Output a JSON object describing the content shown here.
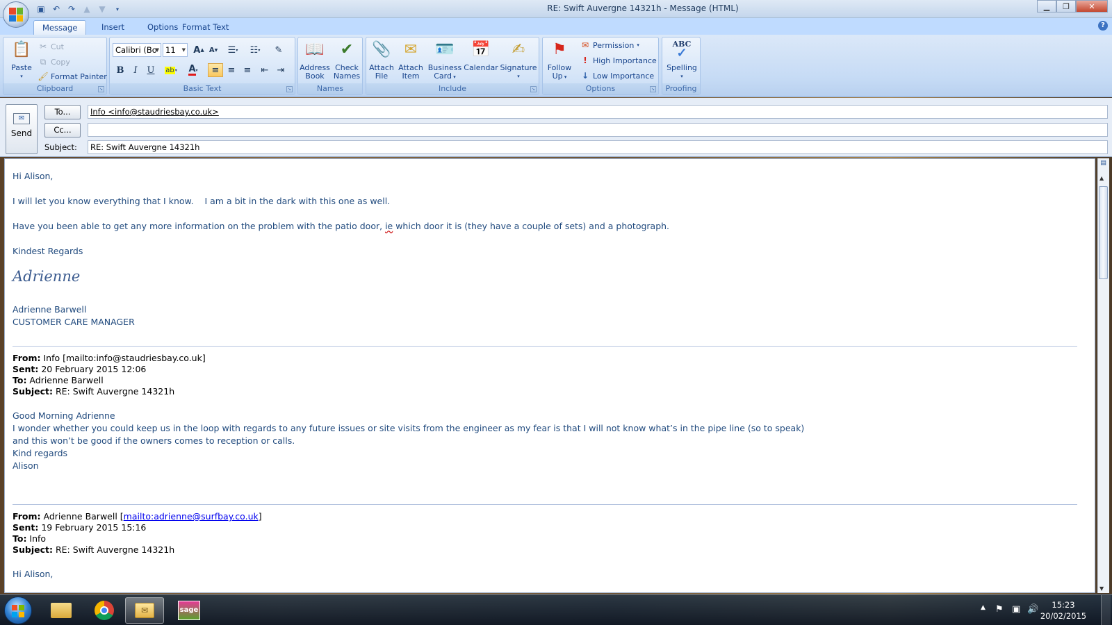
{
  "window": {
    "title": "RE: Swift Auvergne 14321h - Message (HTML)"
  },
  "tabs": [
    "Message",
    "Insert",
    "Options",
    "Format Text"
  ],
  "ribbon": {
    "clipboard": {
      "label": "Clipboard",
      "paste": "Paste",
      "cut": "Cut",
      "copy": "Copy",
      "format_painter": "Format Painter"
    },
    "basic_text": {
      "label": "Basic Text",
      "font": "Calibri (Bo",
      "size": "11",
      "bold": "B",
      "italic": "I",
      "underline": "U"
    },
    "names": {
      "label": "Names",
      "address_book_1": "Address",
      "address_book_2": "Book",
      "check_names_1": "Check",
      "check_names_2": "Names"
    },
    "include": {
      "label": "Include",
      "attach_file_1": "Attach",
      "attach_file_2": "File",
      "attach_item_1": "Attach",
      "attach_item_2": "Item",
      "business_card_1": "Business",
      "business_card_2": "Card",
      "calendar": "Calendar",
      "signature": "Signature"
    },
    "options": {
      "label": "Options",
      "follow_up_1": "Follow",
      "follow_up_2": "Up",
      "permission": "Permission",
      "high_importance": "High Importance",
      "low_importance": "Low Importance"
    },
    "proofing": {
      "label": "Proofing",
      "spelling_icon": "ABC",
      "spelling": "Spelling"
    }
  },
  "header": {
    "send": "Send",
    "to_button": "To...",
    "cc_button": "Cc...",
    "subject_label": "Subject:",
    "to_value": "Info <info@staudriesbay.co.uk>",
    "cc_value": "",
    "subject_value": "RE: Swift Auvergne 14321h"
  },
  "body": {
    "greeting": "Hi Alison,",
    "line1": "I will let you know everything that I know.    I am a bit in the dark with this one as well.",
    "line2_pre": "Have you been able to get any more information on the problem with the patio door, ",
    "line2_ie": "ie",
    "line2_post": " which door it is (they have a couple of sets) and a photograph.",
    "regards": "Kindest Regards",
    "signature_script": "Adrienne",
    "sig_name": "Adrienne Barwell",
    "sig_title": "CUSTOMER CARE MANAGER",
    "q1": {
      "from_label": "From:",
      "from_value": " Info [mailto:info@staudriesbay.co.uk]",
      "sent_label": "Sent:",
      "sent_value": " 20 February 2015 12:06",
      "to_label": "To:",
      "to_value": " Adrienne Barwell",
      "subject_label": "Subject:",
      "subject_value": " RE: Swift Auvergne 14321h",
      "l1": "Good Morning Adrienne",
      "l2": "I wonder whether you could keep us in the loop with regards to any future issues or site visits from the engineer as my fear is that I will not know what’s in the pipe line (so to speak)",
      "l3": "and this won’t be good if the owners comes to reception or calls.",
      "l4": "Kind regards",
      "l5": "Alison"
    },
    "q2": {
      "from_label": "From:",
      "from_value": " Adrienne Barwell [",
      "from_link": "mailto:adrienne@surfbay.co.uk",
      "from_end": "]",
      "sent_label": "Sent:",
      "sent_value": " 19 February 2015 15:16",
      "to_label": "To:",
      "to_value": " Info",
      "subject_label": "Subject:",
      "subject_value": " RE: Swift Auvergne 14321h",
      "l1": "Hi Alison,"
    }
  },
  "taskbar": {
    "time": "15:23",
    "date": "20/02/2015",
    "sage_label": "sage"
  },
  "colors": {
    "ribbon": "#c6dbf5",
    "body_text": "#1f497d",
    "link": "#0000ee"
  }
}
